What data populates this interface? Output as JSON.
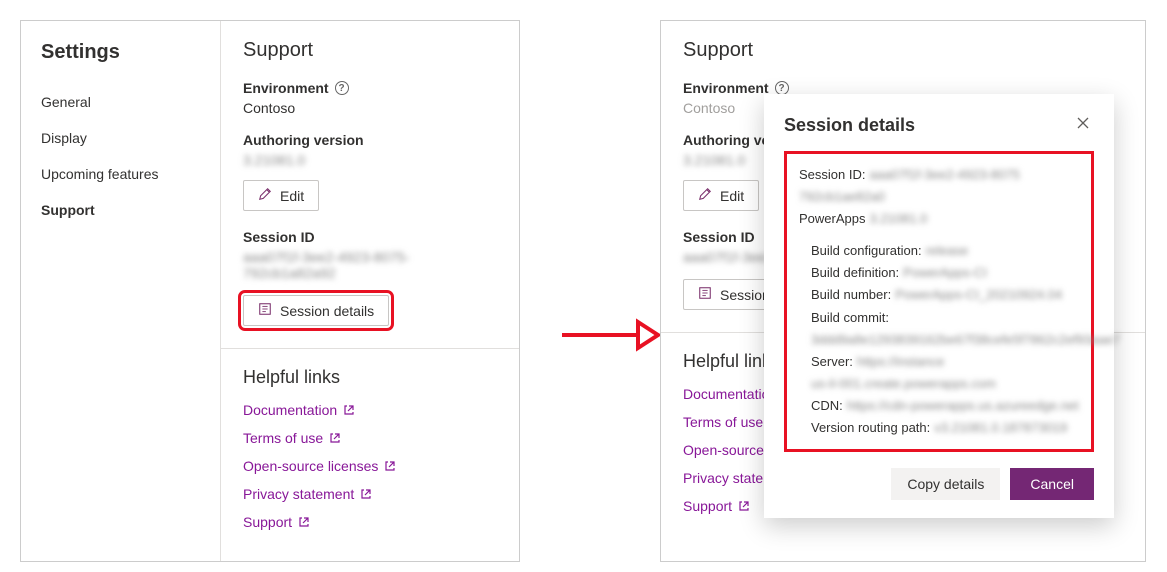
{
  "sidebar": {
    "title": "Settings",
    "items": [
      {
        "label": "General"
      },
      {
        "label": "Display"
      },
      {
        "label": "Upcoming features"
      },
      {
        "label": "Support"
      }
    ]
  },
  "support": {
    "title": "Support",
    "env_label": "Environment",
    "env_value": "Contoso",
    "authver_label": "Authoring version",
    "authver_value": "3.21081.0",
    "edit_label": "Edit",
    "session_label": "Session ID",
    "session_value": "aaa07f1f-3ee2-4923-8075-792cb1a82a92",
    "session_details_label": "Session details",
    "links_title": "Helpful links",
    "links": [
      {
        "label": "Documentation"
      },
      {
        "label": "Terms of use"
      },
      {
        "label": "Open-source licenses"
      },
      {
        "label": "Privacy statement"
      },
      {
        "label": "Support"
      }
    ]
  },
  "dialog": {
    "title": "Session details",
    "rows": {
      "session_id_k": "Session ID:",
      "session_id_v": "aaa07f1f-3ee2-4923-8075",
      "session_id_v2": "792cb1ae82a0",
      "powerapps_k": "PowerApps",
      "powerapps_v": "3.21081.0",
      "buildcfg_k": "Build configuration:",
      "buildcfg_v": "release",
      "builddef_k": "Build definition:",
      "builddef_v": "PowerApps-CI",
      "buildnum_k": "Build number:",
      "buildnum_v": "PowerApps-CI_20210924.04",
      "buildcommit_k": "Build commit:",
      "buildcommit_v": "3ddd9a8e1293839162be67f38cefe5f7862c2ef93aae7",
      "server_k": "Server:",
      "server_v": "https://instance",
      "server_v2": "us-il-001.create.powerapps.com",
      "cdn_k": "CDN:",
      "cdn_v": "https://cdn-powerapps.us.azureedge.net",
      "vroute_k": "Version routing path:",
      "vroute_v": "v3.21081.0.187873019"
    },
    "copy_label": "Copy details",
    "cancel_label": "Cancel"
  }
}
